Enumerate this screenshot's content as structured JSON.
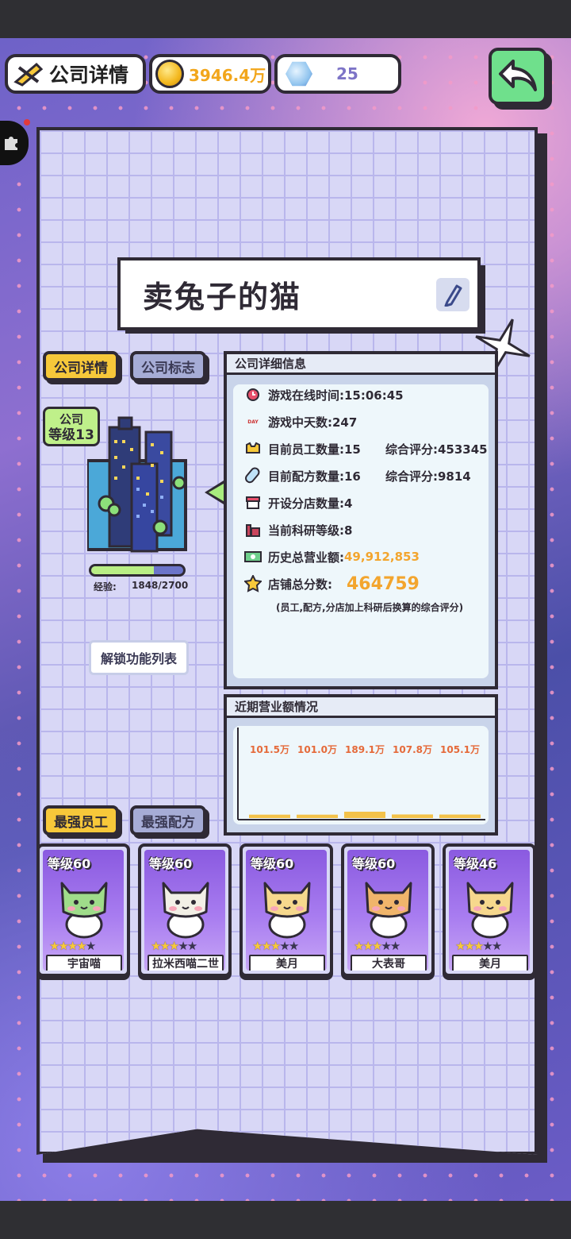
{
  "topbar": {
    "title": "公司详情",
    "coins": "3946.4万",
    "gems": "25"
  },
  "company": {
    "name": "卖兔子的猫",
    "level_prefix": "公司",
    "level_text": "等级13",
    "xp_label": "经验:",
    "xp_value": "1848/2700",
    "xp_fraction": 0.684,
    "unlock_label": "解锁功能列表"
  },
  "tabs": {
    "details": "公司详情",
    "logo": "公司标志",
    "best_staff": "最强员工",
    "best_recipe": "最强配方"
  },
  "details": {
    "header": "公司详细信息",
    "online_time": "游戏在线时间:15:06:45",
    "game_days": "游戏中天数:247",
    "staff_count": "目前员工数量:15",
    "staff_score": "综合评分:453345",
    "recipe_count": "目前配方数量:16",
    "recipe_score": "综合评分:9814",
    "branch_count": "开设分店数量:4",
    "research_level": "当前科研等级:8",
    "revenue_label": "历史总营业额:",
    "revenue_value": "49,912,853",
    "store_score_label": "店铺总分数:",
    "store_score_value": "464759",
    "note": "(员工,配方,分店加上科研后换算的综合评分)",
    "day_icon_text": "DAY"
  },
  "revenue_chart": {
    "header": "近期营业额情况",
    "labels": [
      "101.5万",
      "101.0万",
      "189.1万",
      "107.8万",
      "105.1万"
    ],
    "values": [
      101.5,
      101.0,
      189.1,
      107.8,
      105.1
    ]
  },
  "employees": [
    {
      "level": "等级60",
      "name": "宇宙喵",
      "stars": 4,
      "color": "#9fdc8a"
    },
    {
      "level": "等级60",
      "name": "拉米西喵二世",
      "stars": 3,
      "color": "#f2efe6"
    },
    {
      "level": "等级60",
      "name": "美月",
      "stars": 3,
      "color": "#f6d88d"
    },
    {
      "level": "等级60",
      "name": "大表哥",
      "stars": 3,
      "color": "#f0b56b"
    },
    {
      "level": "等级46",
      "name": "美月",
      "stars": 3,
      "color": "#f6d88d"
    }
  ]
}
